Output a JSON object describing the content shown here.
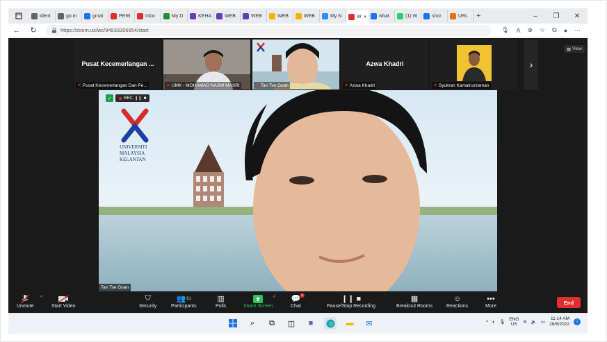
{
  "browser": {
    "tabs": [
      {
        "label": "Ident",
        "icon": "document-icon",
        "color": "#5f6368"
      },
      {
        "label": "go.m",
        "icon": "document-icon",
        "color": "#5f6368"
      },
      {
        "label": "gmai",
        "icon": "search-icon",
        "color": "#1a73e8"
      },
      {
        "label": "PERI",
        "icon": "gmail-icon",
        "color": "#d93025"
      },
      {
        "label": "Inbo",
        "icon": "gmail-icon",
        "color": "#d93025"
      },
      {
        "label": "My D",
        "icon": "drive-icon",
        "color": "#1e8e3e"
      },
      {
        "label": "KEHA",
        "icon": "forms-icon",
        "color": "#673ab7"
      },
      {
        "label": "WEB",
        "icon": "forms-icon",
        "color": "#673ab7"
      },
      {
        "label": "WEB",
        "icon": "forms-icon",
        "color": "#673ab7"
      },
      {
        "label": "WEB",
        "icon": "slides-icon",
        "color": "#f4b400"
      },
      {
        "label": "WEB",
        "icon": "slides-icon",
        "color": "#f4b400"
      },
      {
        "label": "My N",
        "icon": "zoom-icon",
        "color": "#2d8cff"
      },
      {
        "label": "W",
        "icon": "record-icon",
        "color": "#e02f2f",
        "active": true
      },
      {
        "label": "what",
        "icon": "search-icon",
        "color": "#1a73e8"
      },
      {
        "label": "(1) W",
        "icon": "whatsapp-icon",
        "color": "#25d366"
      },
      {
        "label": "shor",
        "icon": "search-icon",
        "color": "#1a73e8"
      },
      {
        "label": "URL",
        "icon": "url-icon",
        "color": "#e8710a"
      }
    ],
    "new_tab_label": "+",
    "url": "https://zoom.us/wc/94933306954/start"
  },
  "zoom": {
    "view_label": "View",
    "thumbnails": [
      {
        "display_name": "Pusat Kecemerlangan ...",
        "caption": "Pusat Kecemerlangan Dan Pe...",
        "type": "name"
      },
      {
        "display_name": "",
        "caption": "UMK - MOHAMAD NAJMI MASRI",
        "type": "video"
      },
      {
        "display_name": "",
        "caption": "Tan Tse Guan",
        "type": "video",
        "speaking": true
      },
      {
        "display_name": "Azwa Khadri",
        "caption": "Azwa Khadri",
        "type": "name"
      },
      {
        "display_name": "",
        "caption": "Syukran Kamalruzzaman",
        "type": "video"
      }
    ],
    "main_video": {
      "speaker_name": "Tan Tse Guan",
      "rec_label": "REC",
      "logo_lines": [
        "UNIVERSITI",
        "MALAYSIA",
        "KELANTAN"
      ]
    },
    "toolbar": {
      "unmute": "Unmute",
      "start_video": "Start Video",
      "security": "Security",
      "participants": "Participants",
      "participants_count": "81",
      "polls": "Polls",
      "share_screen": "Share Screen",
      "chat": "Chat",
      "chat_badge": "1",
      "recording": "Pause/Stop Recording",
      "breakout": "Breakout Rooms",
      "reactions": "Reactions",
      "more": "More",
      "end": "End"
    }
  },
  "taskbar": {
    "lang_top": "ENG",
    "lang_bottom": "US",
    "time": "11:14 AM",
    "date": "28/6/2022"
  }
}
